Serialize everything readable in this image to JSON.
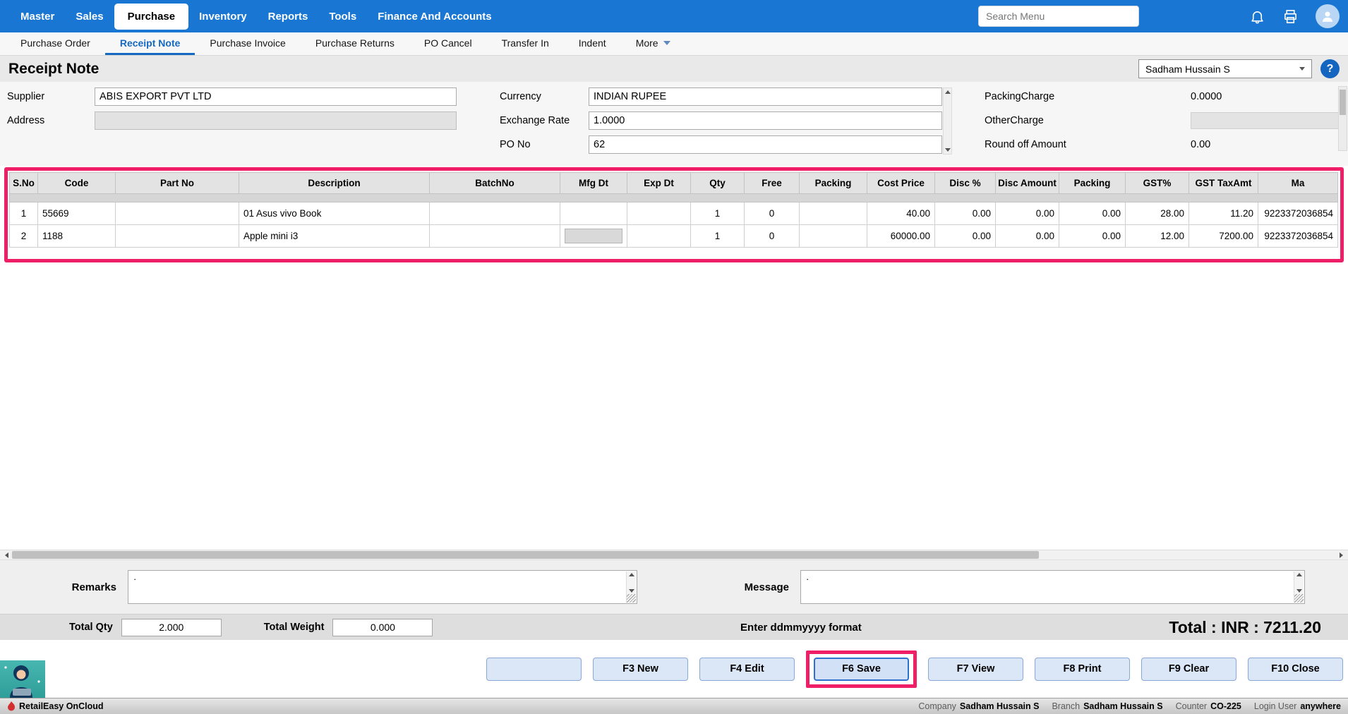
{
  "colors": {
    "accent_blue": "#1976d2",
    "active_link_blue": "#1669c1",
    "annotation_pink": "#ee1e67",
    "button_fill": "#dbe6f7"
  },
  "topnav": {
    "items": [
      "Master",
      "Sales",
      "Purchase",
      "Inventory",
      "Reports",
      "Tools",
      "Finance And Accounts"
    ],
    "active_item": "Purchase",
    "search_placeholder": "Search Menu"
  },
  "subnav": {
    "items": [
      "Purchase Order",
      "Receipt Note",
      "Purchase Invoice",
      "Purchase Returns",
      "PO Cancel",
      "Transfer In",
      "Indent",
      "More"
    ],
    "active_item": "Receipt Note"
  },
  "header": {
    "title": "Receipt Note",
    "user_select_value": "Sadham Hussain S",
    "help_label": "?"
  },
  "form": {
    "supplier_label": "Supplier",
    "supplier_value": "ABIS EXPORT PVT LTD",
    "address_label": "Address",
    "address_value": "",
    "currency_label": "Currency",
    "currency_value": "INDIAN RUPEE",
    "exchange_rate_label": "Exchange Rate",
    "exchange_rate_value": "1.0000",
    "po_no_label": "PO No",
    "po_no_value": "62",
    "packing_charge_label": "PackingCharge",
    "packing_charge_value": "0.0000",
    "other_charge_label": "OtherCharge",
    "other_charge_value": "",
    "round_off_label": "Round off Amount",
    "round_off_value": "0.00"
  },
  "grid": {
    "columns": [
      "S.No",
      "Code",
      "Part No",
      "Description",
      "BatchNo",
      "Mfg Dt",
      "Exp Dt",
      "Qty",
      "Free",
      "Packing",
      "Cost Price",
      "Disc %",
      "Disc Amount",
      "Packing",
      "GST%",
      "GST TaxAmt",
      "Ma"
    ],
    "rows": [
      [
        "1",
        "55669",
        "",
        "01 Asus vivo Book",
        "",
        "",
        "",
        "1",
        "0",
        "",
        "40.00",
        "0.00",
        "0.00",
        "0.00",
        "28.00",
        "11.20",
        "9223372036854"
      ],
      [
        "2",
        "1188",
        "",
        "Apple mini i3",
        "",
        "",
        "",
        "1",
        "0",
        "",
        "60000.00",
        "0.00",
        "0.00",
        "0.00",
        "12.00",
        "7200.00",
        "9223372036854"
      ]
    ]
  },
  "footer": {
    "remarks_label": "Remarks",
    "remarks_value": "·",
    "message_label": "Message",
    "message_value": "·",
    "total_qty_label": "Total Qty",
    "total_qty_value": "2.000",
    "total_weight_label": "Total Weight",
    "total_weight_value": "0.000",
    "date_hint": "Enter ddmmyyyy format",
    "grand_total": "Total : INR : 7211.20",
    "buttons": [
      "",
      "F3 New",
      "F4 Edit",
      "F6 Save",
      "F7 View",
      "F8 Print",
      "F9 Clear",
      "F10 Close"
    ]
  },
  "statusbar": {
    "app_name": "RetailEasy OnCloud",
    "company_label": "Company",
    "company_value": "Sadham Hussain S",
    "branch_label": "Branch",
    "branch_value": "Sadham Hussain S",
    "counter_label": "Counter",
    "counter_value": "CO-225",
    "login_label": "Login User",
    "login_value": "anywhere"
  }
}
